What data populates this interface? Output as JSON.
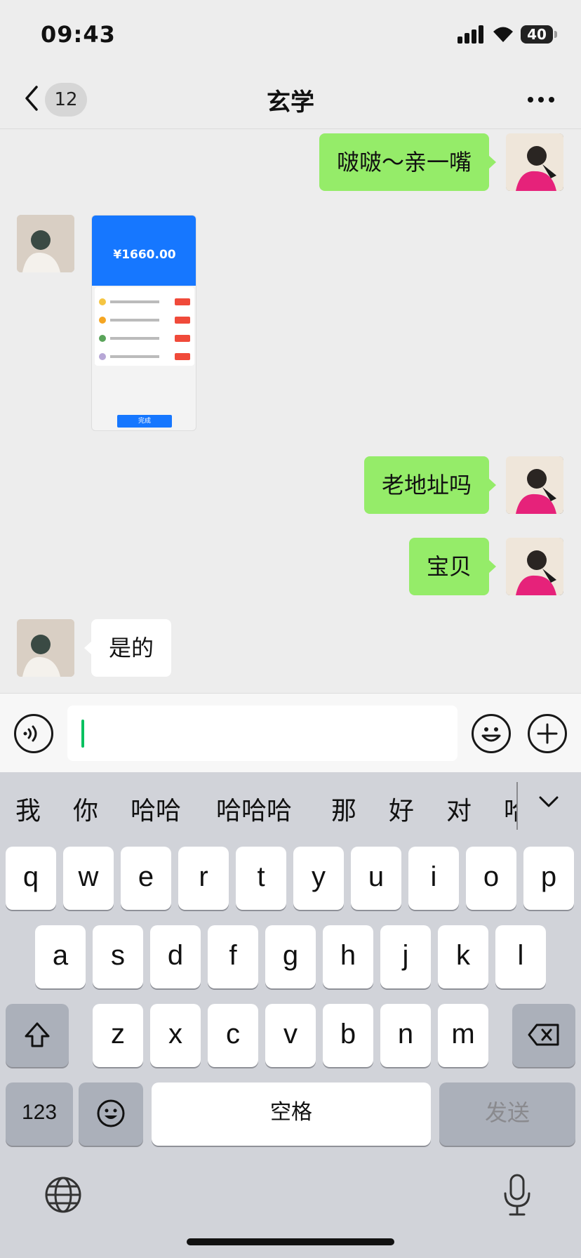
{
  "status_bar": {
    "time": "09:43",
    "battery": "40"
  },
  "nav": {
    "unread_count": "12",
    "title": "玄学",
    "more_icon": "ellipsis-icon"
  },
  "messages": [
    {
      "from": "me",
      "type": "text",
      "text": "啵啵～亲一嘴"
    },
    {
      "from": "other",
      "type": "image"
    },
    {
      "from": "me",
      "type": "text",
      "text": "老地址吗"
    },
    {
      "from": "me",
      "type": "text",
      "text": "宝贝"
    },
    {
      "from": "other",
      "type": "text",
      "text": "是的"
    }
  ],
  "shared_screenshot": {
    "amount": "¥1660.00",
    "done_label": "完成"
  },
  "input_bar": {
    "value": "",
    "voice_icon": "voice-icon",
    "emoji_icon": "emoji-icon",
    "plus_icon": "plus-icon"
  },
  "keyboard": {
    "candidates": [
      "我",
      "你",
      "哈哈",
      "哈哈哈",
      "那",
      "好",
      "对",
      "哈"
    ],
    "row1": [
      "q",
      "w",
      "e",
      "r",
      "t",
      "y",
      "u",
      "i",
      "o",
      "p"
    ],
    "row2": [
      "a",
      "s",
      "d",
      "f",
      "g",
      "h",
      "j",
      "k",
      "l"
    ],
    "row3": [
      "z",
      "x",
      "c",
      "v",
      "b",
      "n",
      "m"
    ],
    "numbers_label": "123",
    "space_label": "空格",
    "send_label": "发送"
  }
}
